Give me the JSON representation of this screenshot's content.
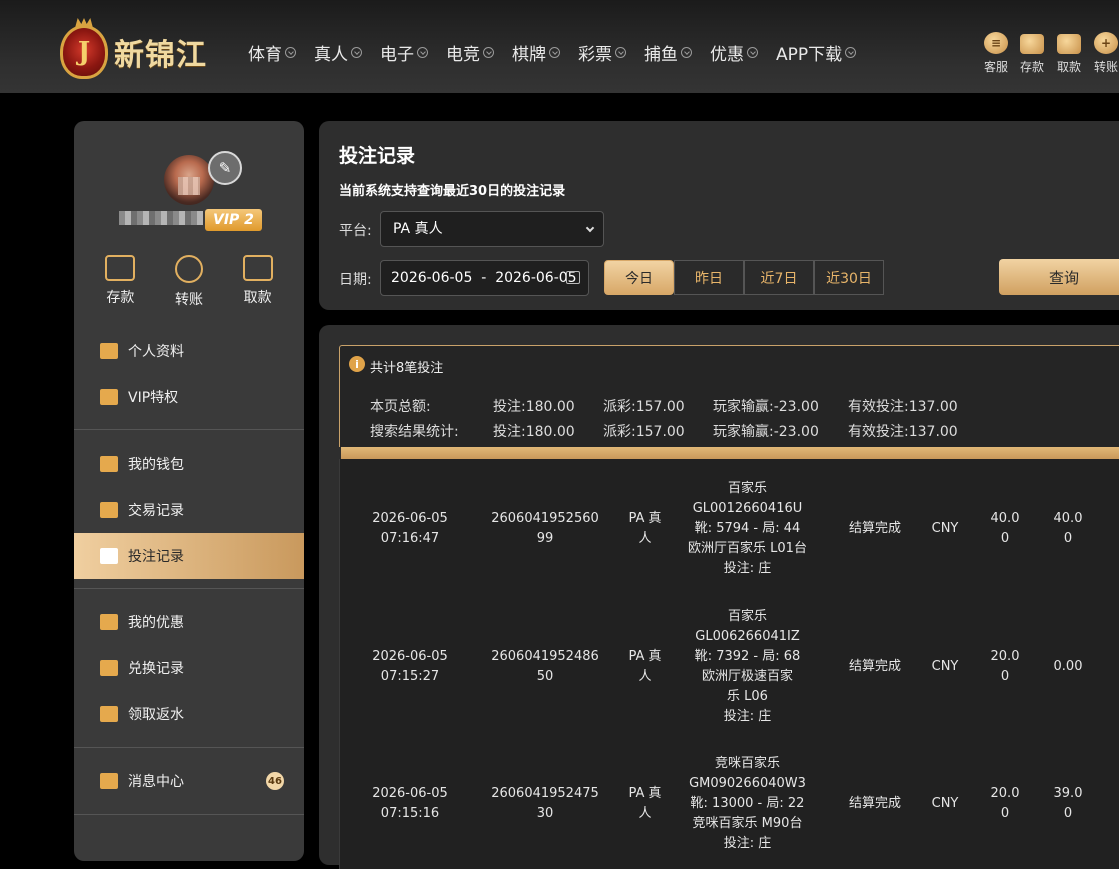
{
  "header": {
    "logo_text": "新锦江",
    "logo_letter": "J",
    "nav": [
      "体育",
      "真人",
      "电子",
      "电竞",
      "棋牌",
      "彩票",
      "捕鱼",
      "优惠",
      "APP下载"
    ],
    "quick": [
      {
        "label": "客服",
        "icon": "customer-service-icon"
      },
      {
        "label": "存款",
        "icon": "wallet-icon"
      },
      {
        "label": "取款",
        "icon": "withdraw-icon"
      },
      {
        "label": "转账",
        "icon": "transfer-icon"
      }
    ]
  },
  "sidebar": {
    "vip": "VIP 2",
    "actions": [
      {
        "label": "存款",
        "icon": "wallet-icon"
      },
      {
        "label": "转账",
        "icon": "transfer-icon"
      },
      {
        "label": "取款",
        "icon": "card-icon"
      }
    ],
    "menu": [
      {
        "label": "个人资料",
        "icon": "id-card-icon"
      },
      {
        "label": "VIP特权",
        "icon": "vip-card-icon"
      },
      {
        "label": "我的钱包",
        "icon": "piggy-bank-icon"
      },
      {
        "label": "交易记录",
        "icon": "document-icon"
      },
      {
        "label": "投注记录",
        "icon": "bet-record-icon"
      },
      {
        "label": "我的优惠",
        "icon": "gift-icon"
      },
      {
        "label": "兑换记录",
        "icon": "exchange-icon"
      },
      {
        "label": "领取返水",
        "icon": "rebate-icon"
      },
      {
        "label": "消息中心",
        "icon": "bell-icon"
      }
    ],
    "message_count": "46",
    "active_index": 4
  },
  "filter": {
    "title": "投注记录",
    "subtitle": "当前系统支持查询最近30日的投注记录",
    "platform_label": "平台:",
    "platform_value": "PA 真人",
    "date_label": "日期:",
    "date_value": "2026-06-05  -  2026-06-05",
    "quick_ranges": [
      "今日",
      "昨日",
      "近7日",
      "近30日"
    ],
    "active_range": 0,
    "query_label": "查询"
  },
  "summary": {
    "title": "共计8笔投注",
    "rows": [
      {
        "label": "本页总额:",
        "bet": "投注:180.00",
        "payout": "派彩:157.00",
        "winloss": "玩家输赢:-23.00",
        "valid": "有效投注:137.00"
      },
      {
        "label": "搜索结果统计:",
        "bet": "投注:180.00",
        "payout": "派彩:157.00",
        "winloss": "玩家输赢:-23.00",
        "valid": "有效投注:137.00"
      }
    ]
  },
  "records": [
    {
      "time": [
        "2026-06-05",
        "07:16:47"
      ],
      "order": [
        "2606041952560",
        "99"
      ],
      "platform": [
        "PA 真",
        "人"
      ],
      "detail": [
        "百家乐",
        "GL0012660416U",
        "靴: 5794 - 局: 44",
        "欧洲厅百家乐 L01台",
        "投注: 庄"
      ],
      "status": "结算完成",
      "currency": "CNY",
      "bet": [
        "40.0",
        "0"
      ],
      "payout": [
        "40.0",
        "0"
      ]
    },
    {
      "time": [
        "2026-06-05",
        "07:15:27"
      ],
      "order": [
        "2606041952486",
        "50"
      ],
      "platform": [
        "PA 真",
        "人"
      ],
      "detail": [
        "百家乐",
        "GL006266041IZ",
        "靴: 7392 - 局: 68",
        "欧洲厅极速百家",
        "乐 L06",
        "投注: 庄"
      ],
      "status": "结算完成",
      "currency": "CNY",
      "bet": [
        "20.0",
        "0"
      ],
      "payout": [
        "0.00"
      ]
    },
    {
      "time": [
        "2026-06-05",
        "07:15:16"
      ],
      "order": [
        "2606041952475",
        "30"
      ],
      "platform": [
        "PA 真",
        "人"
      ],
      "detail": [
        "竞咪百家乐",
        "GM090266040W3",
        "靴: 13000 - 局: 22",
        "竞咪百家乐 M90台",
        "投注: 庄"
      ],
      "status": "结算完成",
      "currency": "CNY",
      "bet": [
        "20.0",
        "0"
      ],
      "payout": [
        "39.0",
        "0"
      ]
    }
  ]
}
